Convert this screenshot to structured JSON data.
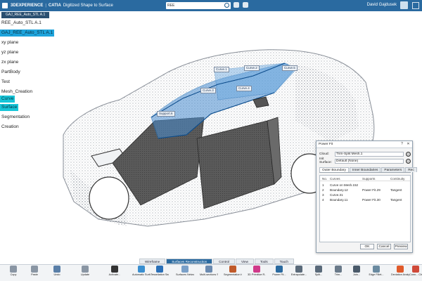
{
  "titlebar": {
    "brand": "3DEXPERIENCE",
    "app": "CATIA",
    "title": "Digitized Shape to Surface",
    "search_scope": "REE",
    "user": "David Gajdusek"
  },
  "document_tab": "GAJ_REE_Auto_STL A.1",
  "tree": {
    "items": [
      {
        "label": "REE_Auto_STL A.1",
        "state": "normal"
      },
      {
        "label": "GAJ_REE_Auto_STL A.1",
        "state": "selected"
      },
      {
        "label": "xy plane",
        "state": "normal"
      },
      {
        "label": "yz plane",
        "state": "normal"
      },
      {
        "label": "zx plane",
        "state": "normal"
      },
      {
        "label": "PartBody",
        "state": "normal"
      },
      {
        "label": "Test",
        "state": "normal"
      },
      {
        "label": "Mesh_Creation",
        "state": "normal"
      },
      {
        "label": "Curve",
        "state": "highlight"
      },
      {
        "label": "Surface",
        "state": "highlight"
      },
      {
        "label": "Segmentation",
        "state": "normal"
      },
      {
        "label": "Creation",
        "state": "normal"
      }
    ]
  },
  "viewport": {
    "labels": [
      "Curve.1",
      "Curve.2",
      "Curve.3",
      "Curve.4",
      "Curve.5",
      "Support.6"
    ]
  },
  "dialog": {
    "title": "Power Fit",
    "cloud_label": "Cloud:",
    "cloud_value": "Trim-Split Mesh.1",
    "init_surface_label": "Init Surface:",
    "init_surface_value": "Default (None)",
    "tabs": [
      "Outer Boundary",
      "Inner Boundaries",
      "Parameters",
      "Rec"
    ],
    "active_tab": 0,
    "columns": [
      "No.",
      "Curves",
      "Supports",
      "Continuity"
    ],
    "rows": [
      {
        "no": "1",
        "curve": "Curve on Mesh.152",
        "support": "",
        "continuity": ""
      },
      {
        "no": "2",
        "curve": "Boundary.12",
        "support": "Power Fit.29",
        "continuity": "Tangent"
      },
      {
        "no": "3",
        "curve": "Curve.31",
        "support": "",
        "continuity": ""
      },
      {
        "no": "4",
        "curve": "Boundary.11",
        "support": "Power Fit.30",
        "continuity": "Tangent"
      }
    ],
    "buttons": [
      "OK",
      "Cancel",
      "Preview"
    ]
  },
  "section_tabs": {
    "items": [
      "Wireframe",
      "Surfaces Reconstruction",
      "Control",
      "View",
      "Tools",
      "Touch"
    ],
    "active": 1
  },
  "toolbar": {
    "tools": [
      {
        "label": "Copy",
        "icon": "copy-icon",
        "color": "#8a96a4"
      },
      {
        "label": "Paste",
        "icon": "paste-icon",
        "color": "#8a96a4"
      },
      {
        "label": "Undo",
        "icon": "undo-icon",
        "color": "#5a7fa8"
      },
      {
        "label": "Update",
        "icon": "update-icon",
        "color": "#8a96a4"
      },
      {
        "label": "Activate...",
        "icon": "activate-icon",
        "color": "#333333"
      },
      {
        "label": "Automatic Surface...",
        "icon": "automatic-surface-icon",
        "color": "#3a8fd0"
      },
      {
        "label": "Tessellation Segmentati...",
        "icon": "tessellation-icon",
        "color": "#2a70b8"
      },
      {
        "label": "Surfaces Network...",
        "icon": "surfaces-network-icon",
        "color": "#7aa0c8"
      },
      {
        "label": "Multi-sections Surface...",
        "icon": "multi-sections-icon",
        "color": "#6a8ab0"
      },
      {
        "label": "Segmentation by Curvature",
        "icon": "segmentation-icon",
        "color": "#c05a2a"
      },
      {
        "label": "3D Primitive R...",
        "icon": "primitive-icon",
        "color": "#d03a8a"
      },
      {
        "label": "Power Fit...",
        "icon": "power-fit-icon",
        "color": "#2a6aa0"
      },
      {
        "label": "Extrapolate...",
        "icon": "extrapolate-icon",
        "color": "#5a6a7a"
      },
      {
        "label": "Split...",
        "icon": "split-icon",
        "color": "#5a6a7a"
      },
      {
        "label": "Trim...",
        "icon": "trim-icon",
        "color": "#6a7a8a"
      },
      {
        "label": "Join...",
        "icon": "join-icon",
        "color": "#4a5a6a"
      },
      {
        "label": "Edge Fillet...",
        "icon": "edge-fillet-icon",
        "color": "#6a8aa0"
      },
      {
        "label": "Deviation Analysis...",
        "icon": "deviation-icon",
        "color": "#e05a2a"
      },
      {
        "label": "Conn... Check...",
        "icon": "connect-check-icon",
        "color": "#d04a3a"
      }
    ]
  }
}
